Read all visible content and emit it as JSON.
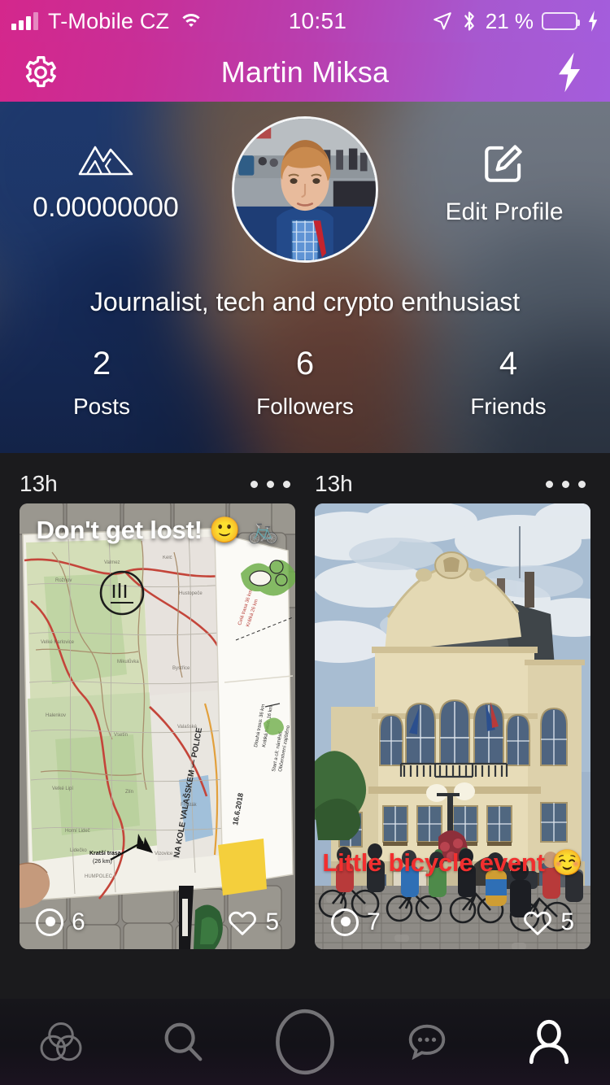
{
  "status_bar": {
    "carrier": "T-Mobile CZ",
    "time": "10:51",
    "battery_percent": "21 %",
    "signal_icon": "signal-bars-icon",
    "wifi_icon": "wifi-icon",
    "location_icon": "location-arrow-icon",
    "bluetooth_icon": "bluetooth-icon",
    "battery_icon": "battery-icon",
    "charging_icon": "charging-bolt-icon"
  },
  "nav": {
    "title": "Martin Miksa",
    "settings_icon": "gear-icon",
    "flash_icon": "lightning-bolt-icon"
  },
  "profile": {
    "balance": "0.00000000",
    "balance_icon": "mountains-icon",
    "edit_label": "Edit Profile",
    "edit_icon": "edit-pencil-square-icon",
    "avatar_icon": "avatar",
    "bio": "Journalist, tech and crypto enthusiast",
    "stats": [
      {
        "value": "2",
        "label": "Posts"
      },
      {
        "value": "6",
        "label": "Followers"
      },
      {
        "value": "4",
        "label": "Friends"
      }
    ]
  },
  "feed": {
    "posts": [
      {
        "time": "13h",
        "caption": "Don't get lost! 🙂 🚲",
        "caption_position": "top",
        "views": "6",
        "likes": "5",
        "menu_icon": "more-options-icon",
        "views_icon": "views-eye-icon",
        "likes_icon": "heart-icon",
        "media": "folded-paper-map-photo"
      },
      {
        "time": "13h",
        "caption": "Little bicycle event ☺️",
        "caption_position": "bottom",
        "views": "7",
        "likes": "5",
        "menu_icon": "more-options-icon",
        "views_icon": "views-eye-icon",
        "likes_icon": "heart-icon",
        "media": "town-hall-cyclists-photo"
      }
    ]
  },
  "tabbar": {
    "items": [
      {
        "icon": "three-circles-feed-icon",
        "active": false
      },
      {
        "icon": "search-icon",
        "active": false
      },
      {
        "icon": "camera-capture-icon",
        "active": false
      },
      {
        "icon": "chat-bubble-icon",
        "active": false
      },
      {
        "icon": "profile-person-icon",
        "active": true
      }
    ]
  },
  "colors": {
    "gradient_start": "#d4278c",
    "gradient_end": "#a45ddc",
    "feed_background": "#1b1b1d",
    "tabbar_background": "#17161b",
    "caption_red": "#f22f2f",
    "battery_green": "#7ed957"
  }
}
